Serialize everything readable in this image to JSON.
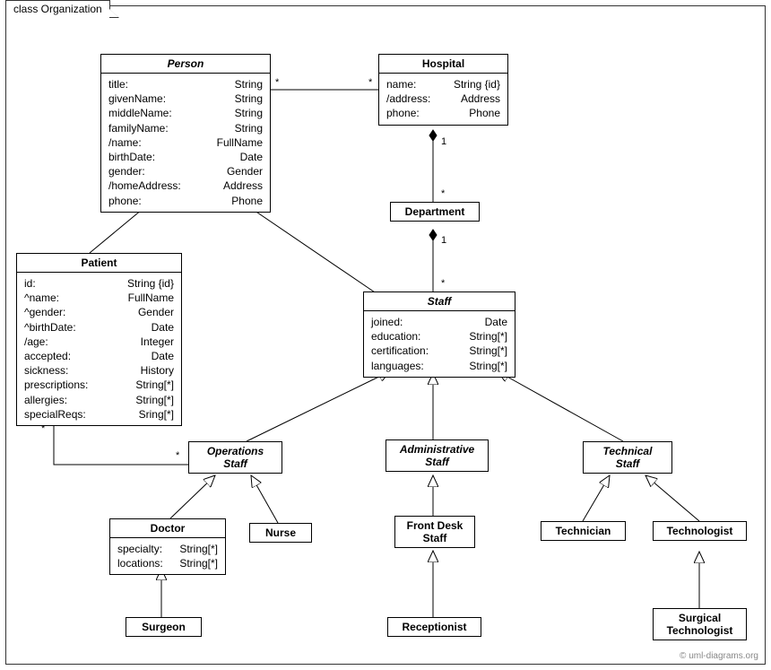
{
  "frame": {
    "label": "class Organization"
  },
  "classes": {
    "person": {
      "name": "Person",
      "attrs": [
        {
          "n": "title:",
          "t": "String"
        },
        {
          "n": "givenName:",
          "t": "String"
        },
        {
          "n": "middleName:",
          "t": "String"
        },
        {
          "n": "familyName:",
          "t": "String"
        },
        {
          "n": "/name:",
          "t": "FullName"
        },
        {
          "n": "birthDate:",
          "t": "Date"
        },
        {
          "n": "gender:",
          "t": "Gender"
        },
        {
          "n": "/homeAddress:",
          "t": "Address"
        },
        {
          "n": "phone:",
          "t": "Phone"
        }
      ]
    },
    "hospital": {
      "name": "Hospital",
      "attrs": [
        {
          "n": "name:",
          "t": "String {id}"
        },
        {
          "n": "/address:",
          "t": "Address"
        },
        {
          "n": "phone:",
          "t": "Phone"
        }
      ]
    },
    "department": {
      "name": "Department"
    },
    "patient": {
      "name": "Patient",
      "attrs": [
        {
          "n": "id:",
          "t": "String {id}"
        },
        {
          "n": "^name:",
          "t": "FullName"
        },
        {
          "n": "^gender:",
          "t": "Gender"
        },
        {
          "n": "^birthDate:",
          "t": "Date"
        },
        {
          "n": "/age:",
          "t": "Integer"
        },
        {
          "n": "accepted:",
          "t": "Date"
        },
        {
          "n": "sickness:",
          "t": "History"
        },
        {
          "n": "prescriptions:",
          "t": "String[*]"
        },
        {
          "n": "allergies:",
          "t": "String[*]"
        },
        {
          "n": "specialReqs:",
          "t": "Sring[*]"
        }
      ]
    },
    "staff": {
      "name": "Staff",
      "attrs": [
        {
          "n": "joined:",
          "t": "Date"
        },
        {
          "n": "education:",
          "t": "String[*]"
        },
        {
          "n": "certification:",
          "t": "String[*]"
        },
        {
          "n": "languages:",
          "t": "String[*]"
        }
      ]
    },
    "opsStaff": {
      "name": "Operations\nStaff"
    },
    "adminStaff": {
      "name": "Administrative\nStaff"
    },
    "techStaff": {
      "name": "Technical\nStaff"
    },
    "doctor": {
      "name": "Doctor",
      "attrs": [
        {
          "n": "specialty:",
          "t": "String[*]"
        },
        {
          "n": "locations:",
          "t": "String[*]"
        }
      ]
    },
    "nurse": {
      "name": "Nurse"
    },
    "frontDesk": {
      "name": "Front Desk\nStaff"
    },
    "technician": {
      "name": "Technician"
    },
    "technologist": {
      "name": "Technologist"
    },
    "surgeon": {
      "name": "Surgeon"
    },
    "receptionist": {
      "name": "Receptionist"
    },
    "surgTech": {
      "name": "Surgical\nTechnologist"
    }
  },
  "mult": {
    "personHospitalL": "*",
    "personHospitalR": "*",
    "hospDept1": "1",
    "hospDeptN": "*",
    "deptStaff1": "1",
    "deptStaffN": "*",
    "patientOpsL": "*",
    "patientOpsR": "*"
  },
  "watermark": "© uml-diagrams.org"
}
